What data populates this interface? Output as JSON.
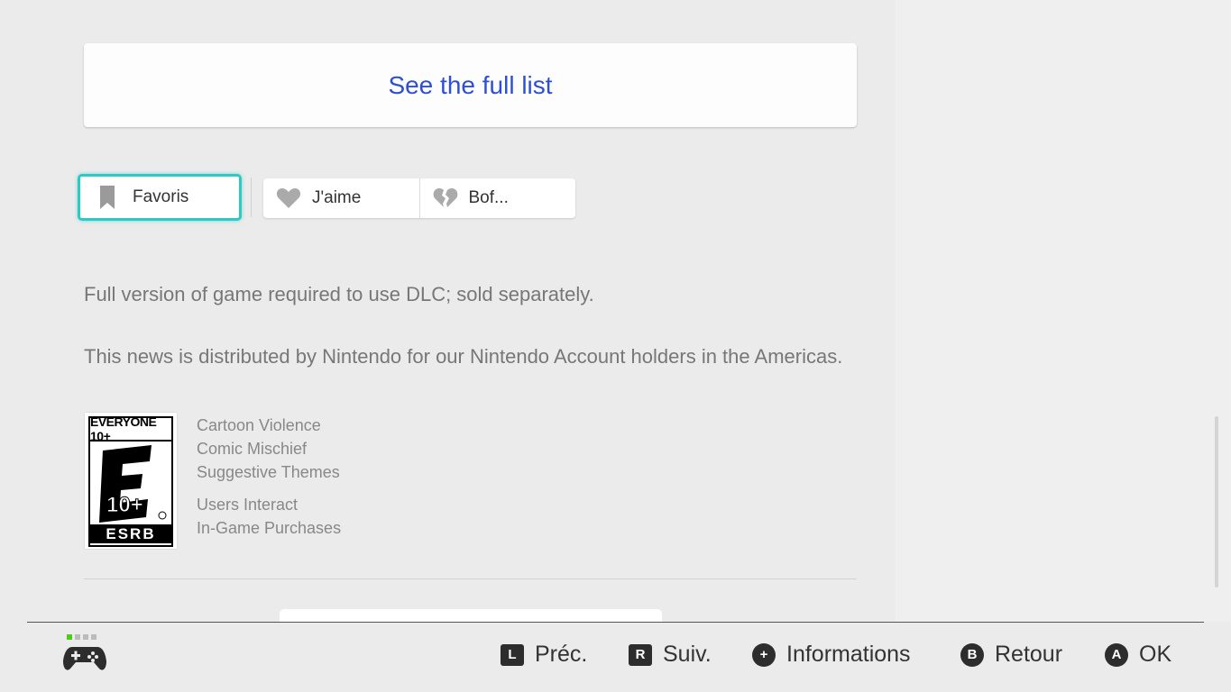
{
  "full_list_label": "See the full list",
  "actions": {
    "favorite": "Favoris",
    "like": "J'aime",
    "dislike": "Bof..."
  },
  "notes": {
    "dlc": "Full version of game required to use DLC; sold separately.",
    "distribution": "This news is distributed by Nintendo for our Nintendo Account holders in the Americas."
  },
  "rating": {
    "label": "EVERYONE 10+",
    "board": "ESRB",
    "descriptors": [
      "Cartoon Violence",
      "Comic Mischief",
      "Suggestive Themes"
    ],
    "interactive": [
      "Users Interact",
      "In-Game Purchases"
    ]
  },
  "footer": {
    "controls": [
      {
        "key": "L",
        "label": "Préc."
      },
      {
        "key": "R",
        "label": "Suiv."
      },
      {
        "key": "+",
        "label": "Informations"
      },
      {
        "key": "B",
        "label": "Retour"
      },
      {
        "key": "A",
        "label": "OK"
      }
    ]
  },
  "colors": {
    "accent": "#2dc9c4",
    "link": "#2f4fd3",
    "controller_active": "#4ccd1a"
  }
}
